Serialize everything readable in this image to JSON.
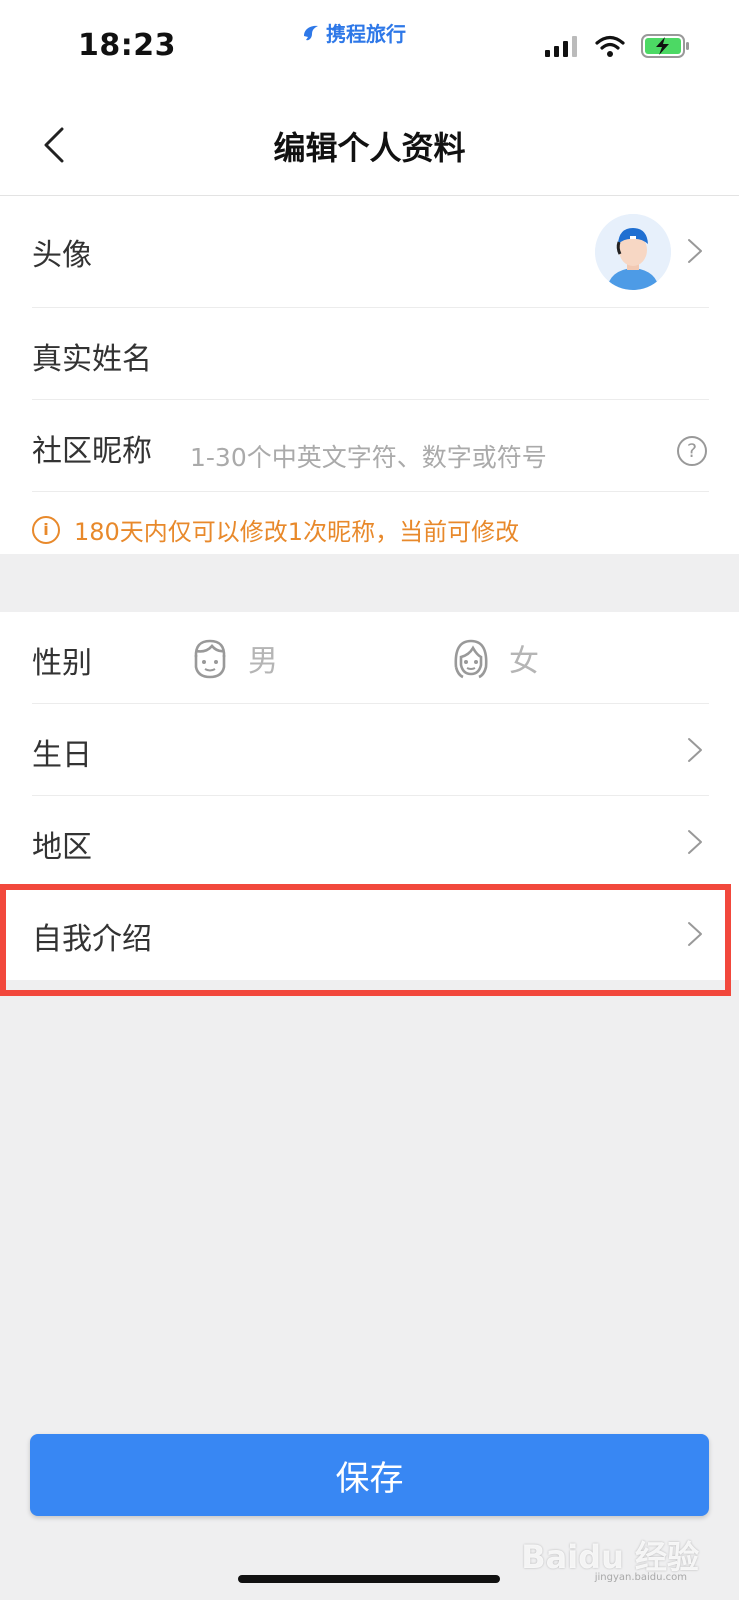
{
  "status": {
    "time": "18:23",
    "brand": "携程旅行"
  },
  "nav": {
    "title": "编辑个人资料"
  },
  "profile": {
    "avatar_label": "头像",
    "realname_label": "真实姓名",
    "nickname_label": "社区昵称",
    "nickname_placeholder": "1-30个中英文字符、数字或符号",
    "help_glyph": "?",
    "notice_glyph": "i",
    "notice": "180天内仅可以修改1次昵称，当前可修改"
  },
  "details": {
    "gender_label": "性别",
    "gender_male": "男",
    "gender_female": "女",
    "birthday_label": "生日",
    "region_label": "地区",
    "intro_label": "自我介绍"
  },
  "actions": {
    "save_label": "保存"
  },
  "watermark": {
    "text": "Baidu 经验",
    "sub": "jingyan.baidu.com"
  },
  "colors": {
    "accent": "#3887f3",
    "warning": "#e8892b",
    "highlight": "#f2483c",
    "brand": "#2e78e8"
  }
}
